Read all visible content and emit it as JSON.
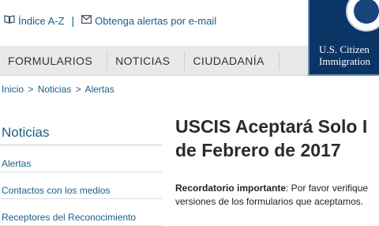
{
  "utility": {
    "index_icon": "book-icon",
    "index_label": "Índice A-Z",
    "separator": "|",
    "alerts_icon": "mail-icon",
    "alerts_label": "Obtenga alertas por e-mail"
  },
  "agency": {
    "line1": "U.S. Citizen",
    "line2": "Immigration"
  },
  "nav": {
    "items": [
      "FORMULARIOS",
      "NOTICIAS",
      "CIUDADANÍA"
    ]
  },
  "breadcrumb": {
    "items": [
      "Inicio",
      "Noticias",
      "Alertas"
    ],
    "separator": ">"
  },
  "sidebar": {
    "title": "Noticias",
    "items": [
      "Alertas",
      "Contactos con los medios",
      "Receptores del Reconocimiento"
    ]
  },
  "article": {
    "title_line1": "USCIS Aceptará Solo I",
    "title_line2": "de Febrero de 2017",
    "lead_label": "Recordatorio importante",
    "lead_text": ": Por favor verifique",
    "line2": "versiones de los formularios que aceptamos."
  },
  "colors": {
    "link": "#1c5e86",
    "brand_navy": "#0b3565",
    "nav_bg": "#e9e9e9"
  }
}
